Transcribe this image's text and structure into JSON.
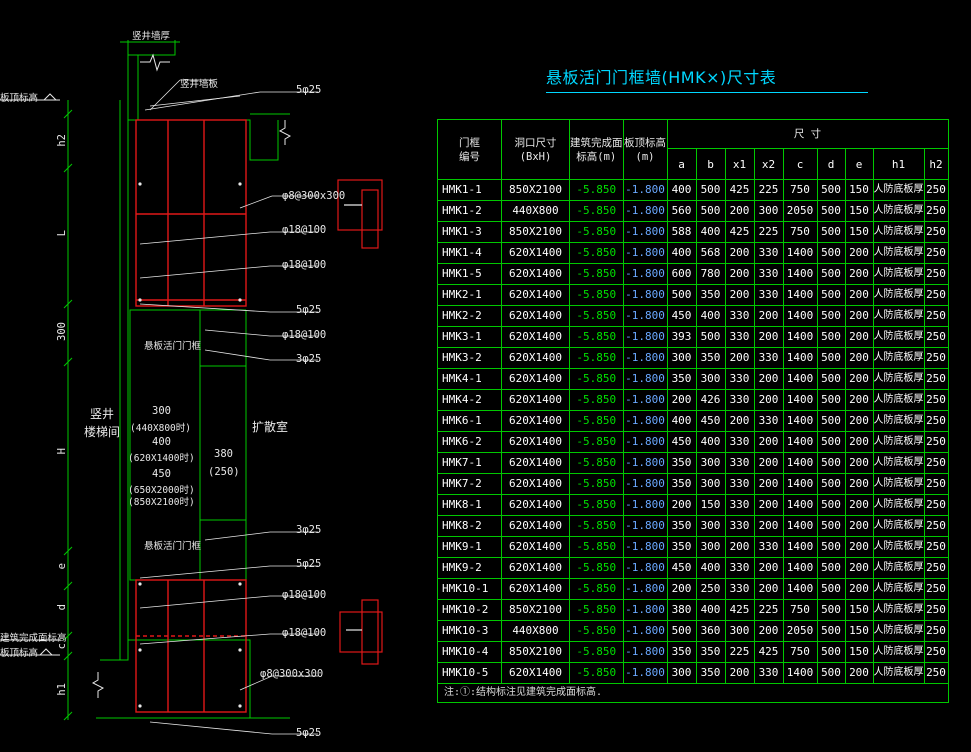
{
  "table_title": "悬板活门门框墙(HMK×)尺寸表",
  "headers": {
    "door_id": "门框\n编号",
    "opening": "洞口尺寸\n(BxH)",
    "finish_elev": "建筑完成面\n标高(m)",
    "slab_elev": "板顶标高\n(m)",
    "dims_group": "尺 寸",
    "dims": [
      "a",
      "b",
      "x1",
      "x2",
      "c",
      "d",
      "e",
      "h1",
      "h2"
    ]
  },
  "rows": [
    [
      "HMK1-1",
      "850X2100",
      "-5.850",
      "-1.800",
      "400",
      "500",
      "425",
      "225",
      "750",
      "500",
      "150",
      "人防底板厚",
      "250"
    ],
    [
      "HMK1-2",
      "440X800",
      "-5.850",
      "-1.800",
      "560",
      "500",
      "200",
      "300",
      "2050",
      "500",
      "150",
      "人防底板厚",
      "250"
    ],
    [
      "HMK1-3",
      "850X2100",
      "-5.850",
      "-1.800",
      "588",
      "400",
      "425",
      "225",
      "750",
      "500",
      "150",
      "人防底板厚",
      "250"
    ],
    [
      "HMK1-4",
      "620X1400",
      "-5.850",
      "-1.800",
      "400",
      "568",
      "200",
      "330",
      "1400",
      "500",
      "200",
      "人防底板厚",
      "250"
    ],
    [
      "HMK1-5",
      "620X1400",
      "-5.850",
      "-1.800",
      "600",
      "780",
      "200",
      "330",
      "1400",
      "500",
      "200",
      "人防底板厚",
      "250"
    ],
    [
      "HMK2-1",
      "620X1400",
      "-5.850",
      "-1.800",
      "500",
      "350",
      "200",
      "330",
      "1400",
      "500",
      "200",
      "人防底板厚",
      "250"
    ],
    [
      "HMK2-2",
      "620X1400",
      "-5.850",
      "-1.800",
      "450",
      "400",
      "330",
      "200",
      "1400",
      "500",
      "200",
      "人防底板厚",
      "250"
    ],
    [
      "HMK3-1",
      "620X1400",
      "-5.850",
      "-1.800",
      "393",
      "500",
      "330",
      "200",
      "1400",
      "500",
      "200",
      "人防底板厚",
      "250"
    ],
    [
      "HMK3-2",
      "620X1400",
      "-5.850",
      "-1.800",
      "300",
      "350",
      "200",
      "330",
      "1400",
      "500",
      "200",
      "人防底板厚",
      "250"
    ],
    [
      "HMK4-1",
      "620X1400",
      "-5.850",
      "-1.800",
      "350",
      "300",
      "330",
      "200",
      "1400",
      "500",
      "200",
      "人防底板厚",
      "250"
    ],
    [
      "HMK4-2",
      "620X1400",
      "-5.850",
      "-1.800",
      "200",
      "426",
      "330",
      "200",
      "1400",
      "500",
      "200",
      "人防底板厚",
      "250"
    ],
    [
      "HMK6-1",
      "620X1400",
      "-5.850",
      "-1.800",
      "400",
      "450",
      "200",
      "330",
      "1400",
      "500",
      "200",
      "人防底板厚",
      "250"
    ],
    [
      "HMK6-2",
      "620X1400",
      "-5.850",
      "-1.800",
      "450",
      "400",
      "330",
      "200",
      "1400",
      "500",
      "200",
      "人防底板厚",
      "250"
    ],
    [
      "HMK7-1",
      "620X1400",
      "-5.850",
      "-1.800",
      "350",
      "300",
      "330",
      "200",
      "1400",
      "500",
      "200",
      "人防底板厚",
      "250"
    ],
    [
      "HMK7-2",
      "620X1400",
      "-5.850",
      "-1.800",
      "350",
      "300",
      "330",
      "200",
      "1400",
      "500",
      "200",
      "人防底板厚",
      "250"
    ],
    [
      "HMK8-1",
      "620X1400",
      "-5.850",
      "-1.800",
      "200",
      "150",
      "330",
      "200",
      "1400",
      "500",
      "200",
      "人防底板厚",
      "250"
    ],
    [
      "HMK8-2",
      "620X1400",
      "-5.850",
      "-1.800",
      "350",
      "300",
      "330",
      "200",
      "1400",
      "500",
      "200",
      "人防底板厚",
      "250"
    ],
    [
      "HMK9-1",
      "620X1400",
      "-5.850",
      "-1.800",
      "350",
      "300",
      "200",
      "330",
      "1400",
      "500",
      "200",
      "人防底板厚",
      "250"
    ],
    [
      "HMK9-2",
      "620X1400",
      "-5.850",
      "-1.800",
      "450",
      "400",
      "330",
      "200",
      "1400",
      "500",
      "200",
      "人防底板厚",
      "250"
    ],
    [
      "HMK10-1",
      "620X1400",
      "-5.850",
      "-1.800",
      "200",
      "250",
      "330",
      "200",
      "1400",
      "500",
      "200",
      "人防底板厚",
      "250"
    ],
    [
      "HMK10-2",
      "850X2100",
      "-5.850",
      "-1.800",
      "380",
      "400",
      "425",
      "225",
      "750",
      "500",
      "150",
      "人防底板厚",
      "250"
    ],
    [
      "HMK10-3",
      "440X800",
      "-5.850",
      "-1.800",
      "500",
      "360",
      "300",
      "200",
      "2050",
      "500",
      "150",
      "人防底板厚",
      "250"
    ],
    [
      "HMK10-4",
      "850X2100",
      "-5.850",
      "-1.800",
      "350",
      "350",
      "225",
      "425",
      "750",
      "500",
      "150",
      "人防底板厚",
      "250"
    ],
    [
      "HMK10-5",
      "620X1400",
      "-5.850",
      "-1.800",
      "300",
      "350",
      "200",
      "330",
      "1400",
      "500",
      "200",
      "人防底板厚",
      "250"
    ]
  ],
  "note": "注:①:结构标注见建筑完成面标高.",
  "drawing": {
    "top_label": "竖井墙厚",
    "shaft_wall": "竖井墙板",
    "elev_slab_top": "板顶标高",
    "elev_finish": "建筑完成面标高",
    "elev_slab_top_2": "板顶标高",
    "rebar": {
      "r1": "5φ25",
      "r2": "φ8@300x300",
      "r3": "φ18@100",
      "r4": "φ18@100",
      "r5": "5φ25",
      "r6": "φ18@100",
      "r7": "3φ25",
      "r8": "3φ25",
      "r9": "5φ25",
      "r10": "φ18@100",
      "r11": "φ18@100",
      "r12": "φ8@300x300",
      "r13": "5φ25"
    },
    "door_label_upper": "悬板活门门框",
    "door_label_lower": "悬板活门门框",
    "room_left": "竖井\n楼梯间",
    "room_right": "扩散室",
    "open_300": "300",
    "open_440": "(440X800时)",
    "open_400": "400",
    "open_620": "(620X1400时)",
    "open_450": "450",
    "open_650": "(650X2000时)",
    "open_850": "(850X2100时)",
    "dim_380": "380",
    "dim_250": "(250)",
    "dim_labels": [
      "h2",
      "L",
      "300",
      "H",
      "e",
      "d",
      "c",
      "h1"
    ]
  },
  "colors": {
    "green": "#00c800",
    "red": "#e01818",
    "cyan": "#00d7ff",
    "white": "#e8e8e8",
    "blue": "#6aa8ff"
  }
}
